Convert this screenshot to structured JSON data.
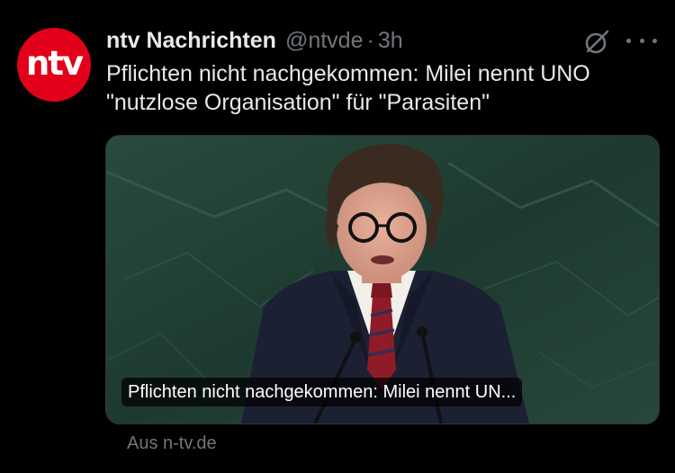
{
  "author": {
    "display_name": "ntv Nachrichten",
    "handle": "@ntvde",
    "separator": "·",
    "time": "3h",
    "avatar_text": "ntv"
  },
  "tweet": {
    "text": "Pflichten nicht nachgekommen: Milei nennt UNO \"nutzlose Organisation\" für \"Parasiten\""
  },
  "card": {
    "title": "Pflichten nicht nachgekommen: Milei nennt UN...",
    "source": "Aus n-tv.de"
  },
  "icons": {
    "grok": "grok-icon",
    "more": "more-options-icon"
  },
  "colors": {
    "background": "#000000",
    "text_primary": "#e7e9ea",
    "text_secondary": "#71767b",
    "avatar_red": "#e2001a",
    "card_border": "#2f3336"
  }
}
